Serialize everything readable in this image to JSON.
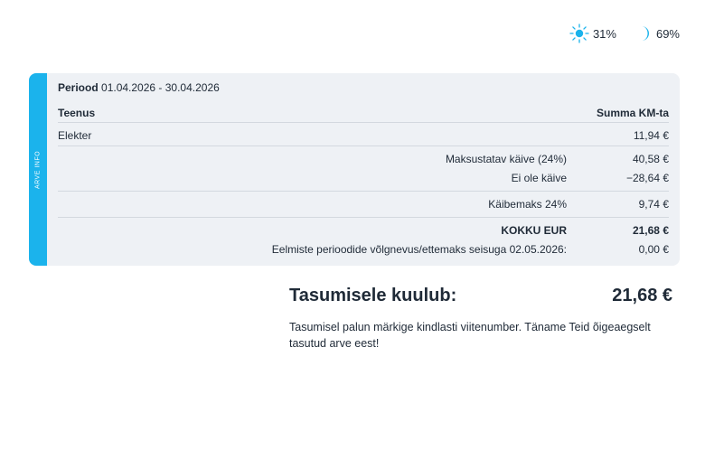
{
  "indicators": {
    "day": {
      "icon": "sun-icon",
      "value": "31%",
      "color": "#1bb3ec"
    },
    "night": {
      "icon": "moon-icon",
      "value": "69%",
      "color": "#1bb3ec"
    }
  },
  "invoice": {
    "side_label": "ARVE INFO",
    "period_label": "Periood",
    "period_value": "01.04.2026 - 30.04.2026",
    "header": {
      "service": "Teenus",
      "sum": "Summa KM-ta"
    },
    "service_row": {
      "name": "Elekter",
      "amount": "11,94 €"
    },
    "taxable_row": {
      "label": "Maksustatav käive (24%)",
      "amount": "40,58 €"
    },
    "nontax_row": {
      "label": "Ei ole käive",
      "amount": "−28,64 €"
    },
    "vat_row": {
      "label": "Käibemaks 24%",
      "amount": "9,74 €"
    },
    "total_row": {
      "label": "KOKKU EUR",
      "amount": "21,68 €"
    },
    "prev_row": {
      "label": "Eelmiste perioodide võlgnevus/ettemaks seisuga 02.05.2026:",
      "amount": "0,00 €"
    }
  },
  "payment": {
    "title": "Tasumisele kuulub:",
    "amount": "21,68 €",
    "note": "Tasumisel palun märkige kindlasti viitenumber. Täname Teid õigeaegselt tasutud arve eest!"
  },
  "colors": {
    "accent": "#1bb3ec",
    "card_bg": "#eef1f5",
    "text": "#1f2a37"
  }
}
